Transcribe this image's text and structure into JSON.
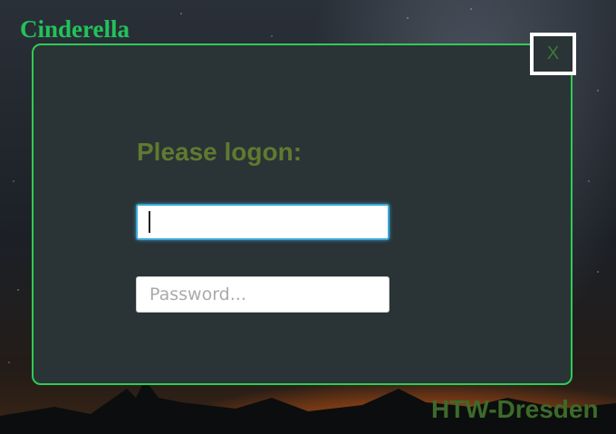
{
  "app": {
    "title": "Cinderella"
  },
  "dialog": {
    "close_label": "X",
    "heading": "Please logon:",
    "username": {
      "value": "",
      "placeholder": ""
    },
    "password": {
      "value": "",
      "placeholder": "Password..."
    }
  },
  "footer": {
    "brand": "HTW-Dresden"
  },
  "colors": {
    "brand_green": "#22c25a",
    "dialog_border": "#2ecc55",
    "dialog_bg": "#2a3336",
    "heading": "#5f7a30",
    "focus_ring": "#3aa7d6"
  },
  "icons": {
    "close": "close-icon"
  }
}
